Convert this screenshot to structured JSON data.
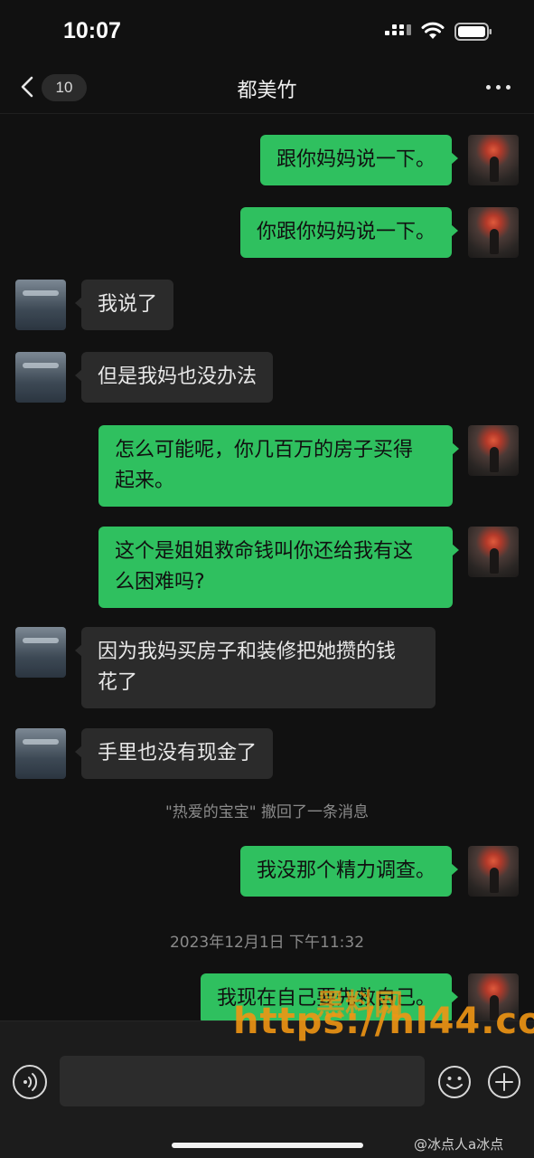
{
  "status_bar": {
    "time": "10:07"
  },
  "nav": {
    "unread_count": "10",
    "title": "都美竹"
  },
  "messages": [
    {
      "from": "me",
      "text": "跟你妈妈说一下。"
    },
    {
      "from": "me",
      "text": "你跟你妈妈说一下。"
    },
    {
      "from": "other",
      "text": "我说了"
    },
    {
      "from": "other",
      "text": "但是我妈也没办法"
    },
    {
      "from": "me",
      "lines": [
        "怎么可能呢，你几百万的房子买得",
        "起来。"
      ]
    },
    {
      "from": "me",
      "lines": [
        "这个是姐姐救命钱叫你还给我有这",
        "么困难吗?"
      ]
    },
    {
      "from": "other",
      "lines": [
        "因为我妈买房子和装修把她攒的钱",
        "花了"
      ]
    },
    {
      "from": "other",
      "text": "手里也没有现金了"
    },
    {
      "type": "system",
      "text": "\"热爱的宝宝\" 撤回了一条消息"
    },
    {
      "from": "me",
      "text": "我没那个精力调查。"
    },
    {
      "type": "timestamp",
      "text": "2023年12月1日 下午11:32"
    },
    {
      "from": "me",
      "text": "我现在自己要先救自己。"
    }
  ],
  "input": {
    "placeholder": ""
  },
  "overlays": {
    "watermark_url": "https://hl44.co",
    "watermark_cn": "黑料网",
    "weibo_credit": "@冰点人a冰点"
  },
  "colors": {
    "sent_bubble": "#2fc05f",
    "received_bubble": "#2b2b2b",
    "background": "#111111"
  }
}
